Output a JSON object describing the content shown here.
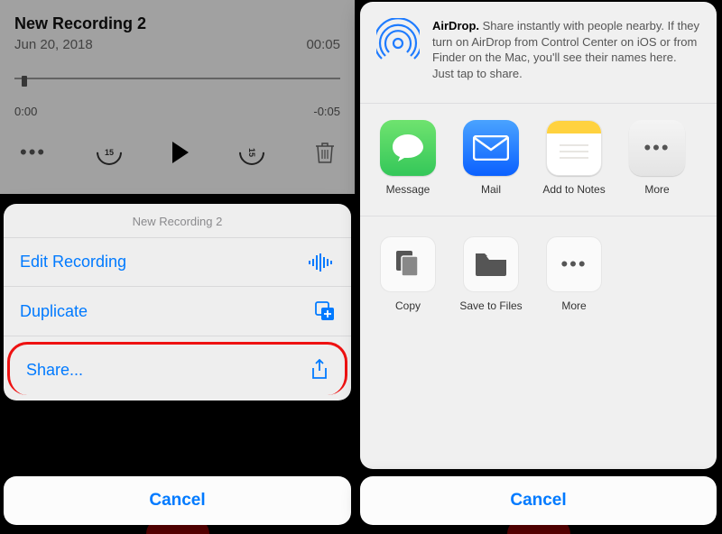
{
  "left": {
    "title": "New Recording 2",
    "date": "Jun 20, 2018",
    "duration": "00:05",
    "time_start": "0:00",
    "time_remaining": "-0:05",
    "skip_seconds": "15",
    "action_sheet": {
      "title": "New Recording 2",
      "edit_label": "Edit Recording",
      "duplicate_label": "Duplicate",
      "share_label": "Share..."
    },
    "cancel_label": "Cancel"
  },
  "right": {
    "airdrop": {
      "title": "AirDrop.",
      "body": "Share instantly with people nearby. If they turn on AirDrop from Control Center on iOS or from Finder on the Mac, you'll see their names here. Just tap to share."
    },
    "apps": {
      "message": "Message",
      "mail": "Mail",
      "notes": "Add to Notes",
      "more": "More"
    },
    "actions": {
      "copy": "Copy",
      "save": "Save to Files",
      "more": "More"
    },
    "cancel_label": "Cancel"
  }
}
